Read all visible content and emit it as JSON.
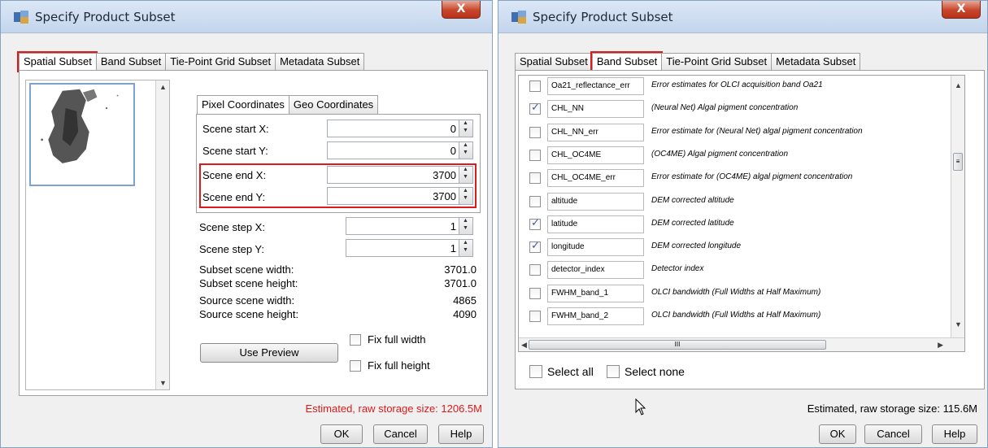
{
  "dialog1": {
    "title": "Specify Product Subset",
    "close_label": "X",
    "tabs": [
      "Spatial Subset",
      "Band Subset",
      "Tie-Point Grid Subset",
      "Metadata Subset"
    ],
    "inner_tabs": [
      "Pixel Coordinates",
      "Geo Coordinates"
    ],
    "fields": {
      "start_x": {
        "label": "Scene start X:",
        "value": "0"
      },
      "start_y": {
        "label": "Scene start Y:",
        "value": "0"
      },
      "end_x": {
        "label": "Scene end X:",
        "value": "3700"
      },
      "end_y": {
        "label": "Scene end Y:",
        "value": "3700"
      },
      "step_x": {
        "label": "Scene step X:",
        "value": "1"
      },
      "step_y": {
        "label": "Scene step Y:",
        "value": "1"
      }
    },
    "info": {
      "subset_width_label": "Subset scene width:",
      "subset_width": "3701.0",
      "subset_height_label": "Subset scene height:",
      "subset_height": "3701.0",
      "source_width_label": "Source scene width:",
      "source_width": "4865",
      "source_height_label": "Source scene height:",
      "source_height": "4090"
    },
    "use_preview": "Use Preview",
    "fix_width": "Fix full width",
    "fix_height": "Fix full height",
    "status": "Estimated, raw storage size: 1206.5M",
    "ok": "OK",
    "cancel": "Cancel",
    "help": "Help"
  },
  "dialog2": {
    "title": "Specify Product Subset",
    "close_label": "X",
    "tabs": [
      "Spatial Subset",
      "Band Subset",
      "Tie-Point Grid Subset",
      "Metadata Subset"
    ],
    "bands": [
      {
        "name": "Oa21_reflectance_err",
        "desc": "Error estimates for OLCI acquisition band Oa21",
        "checked": false
      },
      {
        "name": "CHL_NN",
        "desc": "(Neural Net) Algal pigment concentration",
        "checked": true
      },
      {
        "name": "CHL_NN_err",
        "desc": "Error estimate for (Neural Net) algal pigment concentration",
        "checked": false
      },
      {
        "name": "CHL_OC4ME",
        "desc": "(OC4ME) Algal pigment concentration",
        "checked": false
      },
      {
        "name": "CHL_OC4ME_err",
        "desc": "Error estimate for (OC4ME) algal pigment concentration",
        "checked": false
      },
      {
        "name": "altitude",
        "desc": "DEM corrected altitude",
        "checked": false
      },
      {
        "name": "latitude",
        "desc": "DEM corrected latitude",
        "checked": true
      },
      {
        "name": "longitude",
        "desc": "DEM corrected longitude",
        "checked": true
      },
      {
        "name": "detector_index",
        "desc": "Detector index",
        "checked": false
      },
      {
        "name": "FWHM_band_1",
        "desc": "OLCI bandwidth (Full Widths at Half Maximum)",
        "checked": false
      },
      {
        "name": "FWHM_band_2",
        "desc": "OLCI bandwidth (Full Widths at Half Maximum)",
        "checked": false
      }
    ],
    "scroll_grip": "III",
    "select_all": "Select all",
    "select_none": "Select none",
    "status": "Estimated, raw storage size: 115.6M",
    "ok": "OK",
    "cancel": "Cancel",
    "help": "Help"
  },
  "colors": {
    "highlight": "#e0191b",
    "titlebar": "#c3d5ec",
    "window_bg": "#f0f0f0"
  }
}
